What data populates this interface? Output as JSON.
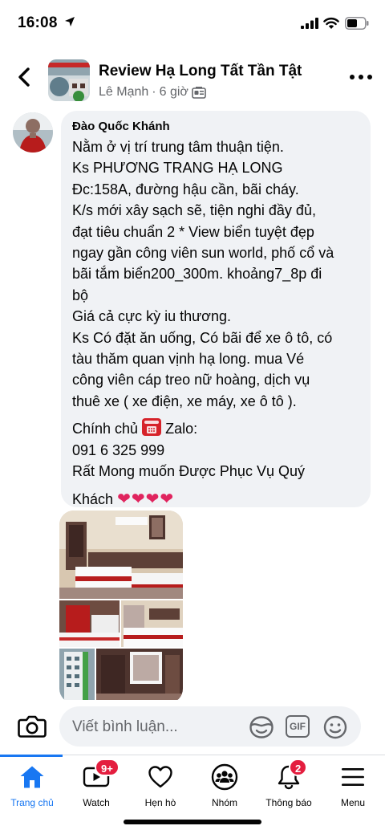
{
  "status_bar": {
    "time": "16:08"
  },
  "header": {
    "group_title": "Review Hạ Long Tất Tần Tật",
    "author": "Lê Mạnh",
    "separator": "·",
    "post_time": "6 giờ"
  },
  "comment": {
    "author_name": "Đào Quốc Khánh",
    "lines": [
      "Nằm ở vị trí trung tâm thuận tiện.",
      "Ks PHƯƠNG TRANG HẠ LONG",
      "Đc:158A, đường hậu cần, bãi cháy.",
      "K/s mới xây sạch sẽ, tiện nghi đầy đủ,",
      "đạt tiêu chuẩn 2 * View biển tuyệt đẹp",
      "ngay gần công viên sun world, phố cổ và",
      "bãi tắm biển200_300m. khoảng7_8p đi",
      "bộ",
      "Giá cả cực kỳ iu thương.",
      "Ks Có đặt ăn uống, Có bãi để xe ô tô, có",
      "tàu thăm quan vịnh hạ long. mua Vé",
      "công viên cáp treo nữ hoàng, dịch vụ",
      "thuê xe ( xe điện, xe máy, xe ô tô )."
    ],
    "contact_prefix": "Chính chủ",
    "contact_suffix": "Zalo:",
    "phone": "091 6 325 999",
    "closing_1": "Rất Mong muốn Được Phục Vụ Quý",
    "closing_2": "Khách",
    "hearts": "❤❤❤❤"
  },
  "composer": {
    "placeholder": "Viết bình luận...",
    "gif_label": "GIF"
  },
  "nav": {
    "items": [
      {
        "label": "Trang chủ",
        "icon": "home-icon",
        "active": true
      },
      {
        "label": "Watch",
        "icon": "watch-icon",
        "badge": "9+"
      },
      {
        "label": "Hẹn hò",
        "icon": "dating-heart-icon"
      },
      {
        "label": "Nhóm",
        "icon": "groups-icon"
      },
      {
        "label": "Thông báo",
        "icon": "bell-icon",
        "badge": "2"
      },
      {
        "label": "Menu",
        "icon": "hamburger-menu-icon"
      }
    ]
  },
  "colors": {
    "accent": "#1877f2",
    "badge": "#e41e3f",
    "bubble": "#f0f2f5",
    "secondary_text": "#65676b"
  }
}
